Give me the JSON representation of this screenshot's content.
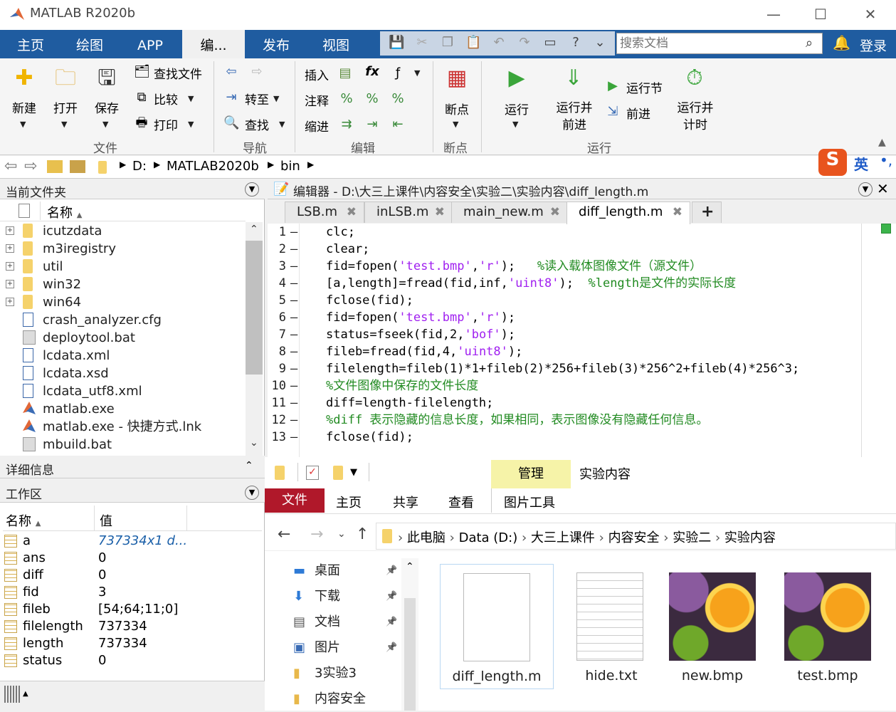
{
  "window": {
    "title": "MATLAB R2020b",
    "min": "—",
    "max": "☐",
    "close": "✕"
  },
  "tabs": [
    "主页",
    "绘图",
    "APP",
    "编...",
    "发布",
    "视图"
  ],
  "search": {
    "placeholder": "搜索文档"
  },
  "login": "登录",
  "ribbon": {
    "file": {
      "new": "新建",
      "open": "打开",
      "save": "保存",
      "find_files": "查找文件",
      "compare": "比较",
      "print": "打印",
      "group": "文件"
    },
    "nav": {
      "goto": "转至",
      "find": "查找",
      "group": "导航"
    },
    "edit": {
      "insert": "插入",
      "comment": "注释",
      "indent": "缩进",
      "group": "编辑"
    },
    "breakpoints": {
      "label": "断点",
      "group": "断点"
    },
    "run": {
      "run": "运行",
      "run_advance": "运行并\n前进",
      "run_section": "运行节",
      "advance": "前进",
      "run_time": "运行并\n计时",
      "group": "运行"
    }
  },
  "address": [
    "D:",
    "MATLAB2020b",
    "bin"
  ],
  "ime": {
    "label": "英"
  },
  "current_folder": {
    "title": "当前文件夹",
    "col_name": "名称",
    "items": [
      {
        "name": "icutzdata",
        "kind": "folder"
      },
      {
        "name": "m3iregistry",
        "kind": "folder"
      },
      {
        "name": "util",
        "kind": "folder"
      },
      {
        "name": "win32",
        "kind": "folder"
      },
      {
        "name": "win64",
        "kind": "folder"
      },
      {
        "name": "crash_analyzer.cfg",
        "kind": "doc"
      },
      {
        "name": "deploytool.bat",
        "kind": "bat"
      },
      {
        "name": "lcdata.xml",
        "kind": "doc"
      },
      {
        "name": "lcdata.xsd",
        "kind": "doc"
      },
      {
        "name": "lcdata_utf8.xml",
        "kind": "doc"
      },
      {
        "name": "matlab.exe",
        "kind": "exe"
      },
      {
        "name": "matlab.exe - 快捷方式.lnk",
        "kind": "exe"
      },
      {
        "name": "mbuild.bat",
        "kind": "bat"
      }
    ]
  },
  "editor": {
    "title": "编辑器 - D:\\大三上课件\\内容安全\\实验二\\实验内容\\diff_length.m",
    "tabs": [
      "LSB.m",
      "inLSB.m",
      "main_new.m",
      "diff_length.m"
    ],
    "add_tab": "+",
    "lines": [
      [
        [
          "clc;",
          ""
        ]
      ],
      [
        [
          "clear;",
          ""
        ]
      ],
      [
        [
          "fid=fopen(",
          ""
        ],
        [
          "'test.bmp'",
          "str"
        ],
        [
          ",",
          ""
        ],
        [
          "'r'",
          "str"
        ],
        [
          ");   ",
          ""
        ],
        [
          "%读入载体图像文件（源文件）",
          "cmt"
        ]
      ],
      [
        [
          "[a,length]=fread(fid,inf,",
          ""
        ],
        [
          "'uint8'",
          "str"
        ],
        [
          ");  ",
          ""
        ],
        [
          "%length是文件的实际长度",
          "cmt"
        ]
      ],
      [
        [
          "fclose(fid);",
          ""
        ]
      ],
      [
        [
          "fid=fopen(",
          ""
        ],
        [
          "'test.bmp'",
          "str"
        ],
        [
          ",",
          ""
        ],
        [
          "'r'",
          "str"
        ],
        [
          ");",
          ""
        ]
      ],
      [
        [
          "status=fseek(fid,2,",
          ""
        ],
        [
          "'bof'",
          "str"
        ],
        [
          ");",
          ""
        ]
      ],
      [
        [
          "fileb=fread(fid,4,",
          ""
        ],
        [
          "'uint8'",
          "str"
        ],
        [
          ");",
          ""
        ]
      ],
      [
        [
          "filelength=fileb(1)*1+fileb(2)*256+fileb(3)*256^2+fileb(4)*256^3;",
          ""
        ]
      ],
      [
        [
          "%文件图像中保存的文件长度",
          "cmt"
        ]
      ],
      [
        [
          "diff=length-filelength;",
          ""
        ]
      ],
      [
        [
          "%diff 表示隐藏的信息长度，如果相同，表示图像没有隐藏任何信息。",
          "cmt"
        ]
      ],
      [
        [
          "fclose(fid);",
          ""
        ]
      ]
    ]
  },
  "details": {
    "title": "详细信息"
  },
  "workspace": {
    "title": "工作区",
    "col_name": "名称",
    "col_value": "值",
    "vars": [
      {
        "name": "a",
        "value": "737334x1 d..."
      },
      {
        "name": "ans",
        "value": "0"
      },
      {
        "name": "diff",
        "value": "0"
      },
      {
        "name": "fid",
        "value": "3"
      },
      {
        "name": "fileb",
        "value": "[54;64;11;0]"
      },
      {
        "name": "filelength",
        "value": "737334"
      },
      {
        "name": "length",
        "value": "737334"
      },
      {
        "name": "status",
        "value": "0"
      }
    ]
  },
  "explorer": {
    "manage": "管理",
    "context_title": "实验内容",
    "ribbon_tabs": [
      "文件",
      "主页",
      "共享",
      "查看",
      "图片工具"
    ],
    "path": [
      "此电脑",
      "Data (D:)",
      "大三上课件",
      "内容安全",
      "实验二",
      "实验内容"
    ],
    "nav": [
      "桌面",
      "下载",
      "文档",
      "图片",
      "3实验3",
      "内容安全"
    ],
    "files": [
      "diff_length.m",
      "hide.txt",
      "new.bmp",
      "test.bmp"
    ]
  }
}
